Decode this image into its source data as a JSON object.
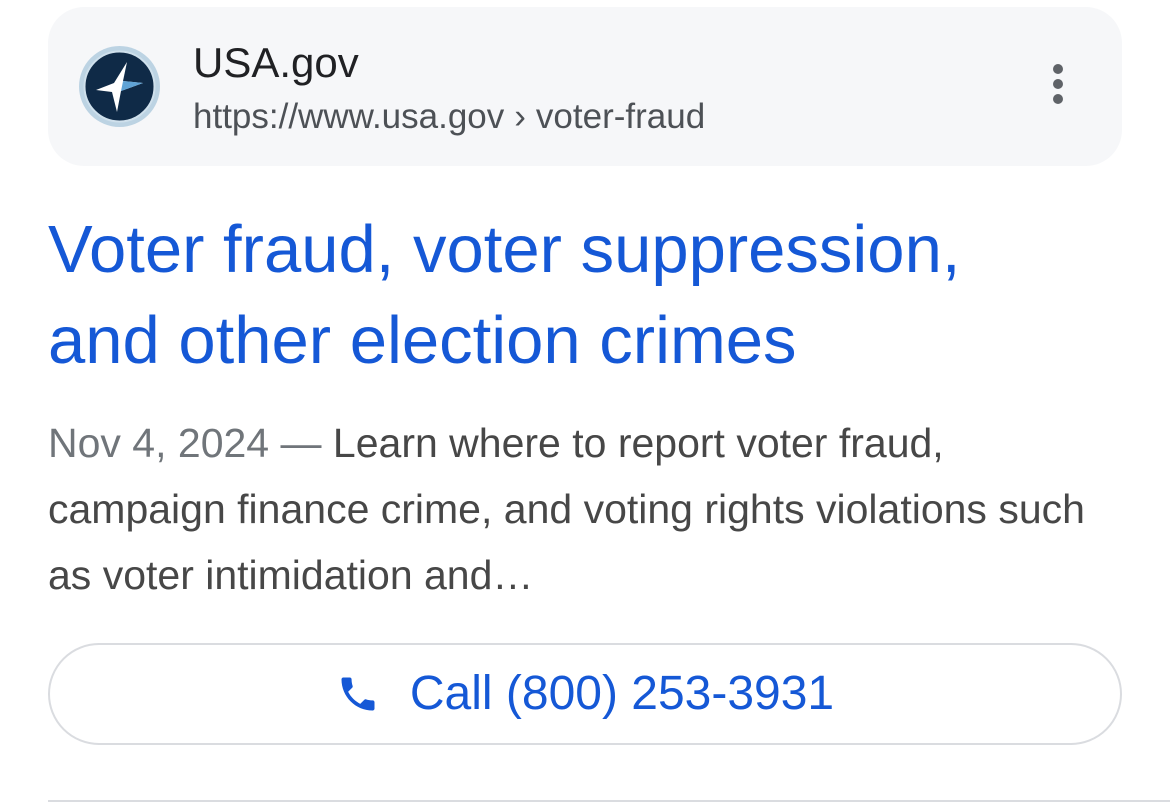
{
  "result": {
    "site_name": "USA.gov",
    "url_base": "https://www.usa.gov",
    "url_separator": "›",
    "url_path": "voter-fraud",
    "favicon_icon": "usa-gov-star-logo-icon",
    "more_icon": "more-vert-icon",
    "title_line1": "Voter fraud, voter suppression,",
    "title_line2": "and other election crimes",
    "date": "Nov 4, 2024",
    "dash": "—",
    "snippet": "Learn where to report voter fraud, campaign finance crime, and voting rights violations such as voter intimidation and…",
    "call_label": "Call (800) 253-3931",
    "call_icon": "phone-icon"
  },
  "colors": {
    "link": "#1558d6",
    "source_bar_bg": "#f6f7f9",
    "favicon_navy": "#0f2a47",
    "favicon_ring": "#bcd3e3",
    "text_dark": "#202124",
    "text_muted": "#4d5156"
  }
}
